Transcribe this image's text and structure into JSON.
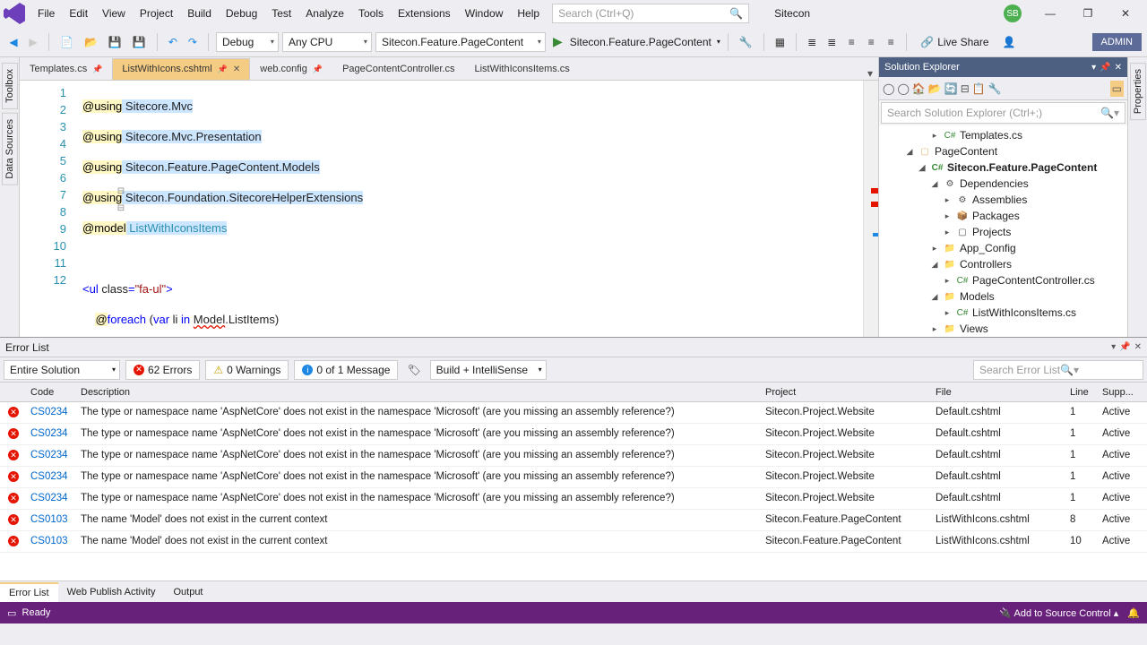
{
  "menu": [
    "File",
    "Edit",
    "View",
    "Project",
    "Build",
    "Debug",
    "Test",
    "Analyze",
    "Tools",
    "Extensions",
    "Window",
    "Help"
  ],
  "searchPlaceholder": "Search (Ctrl+Q)",
  "solutionName": "Sitecon",
  "avatar": "SB",
  "toolbar": {
    "config": "Debug",
    "platform": "Any CPU",
    "startup": "Sitecon.Feature.PageContent",
    "runTarget": "Sitecon.Feature.PageContent",
    "liveShare": "Live Share",
    "admin": "ADMIN"
  },
  "leftTabs": [
    "Toolbox",
    "Data Sources"
  ],
  "rightTab": "Properties",
  "docTabs": [
    {
      "name": "Templates.cs",
      "active": false,
      "pin": true
    },
    {
      "name": "ListWithIcons.cshtml",
      "active": true,
      "pin": true,
      "close": true
    },
    {
      "name": "web.config",
      "active": false,
      "pin": true
    },
    {
      "name": "PageContentController.cs",
      "active": false
    },
    {
      "name": "ListWithIconsItems.cs",
      "active": false
    }
  ],
  "code": {
    "lines": [
      "1",
      "2",
      "3",
      "4",
      "5",
      "6",
      "7",
      "8",
      "9",
      "10",
      "11",
      "12"
    ]
  },
  "solExp": {
    "title": "Solution Explorer",
    "search": "Search Solution Explorer (Ctrl+;)",
    "nodes": [
      {
        "indent": 4,
        "exp": "▸",
        "icon": "C#",
        "cls": "ic-cs",
        "label": "Templates.cs"
      },
      {
        "indent": 2,
        "exp": "◢",
        "icon": "▢",
        "cls": "ic-fold",
        "label": "PageContent"
      },
      {
        "indent": 3,
        "exp": "◢",
        "icon": "C#",
        "cls": "ic-cs",
        "label": "Sitecon.Feature.PageContent",
        "bold": true
      },
      {
        "indent": 4,
        "exp": "◢",
        "icon": "⚙",
        "cls": "ic-ref",
        "label": "Dependencies"
      },
      {
        "indent": 5,
        "exp": "▸",
        "icon": "⚙",
        "cls": "ic-ref",
        "label": "Assemblies"
      },
      {
        "indent": 5,
        "exp": "▸",
        "icon": "📦",
        "cls": "ic-ref",
        "label": "Packages"
      },
      {
        "indent": 5,
        "exp": "▸",
        "icon": "▢",
        "cls": "ic-ref",
        "label": "Projects"
      },
      {
        "indent": 4,
        "exp": "▸",
        "icon": "📁",
        "cls": "ic-fold",
        "label": "App_Config"
      },
      {
        "indent": 4,
        "exp": "◢",
        "icon": "📁",
        "cls": "ic-fold",
        "label": "Controllers"
      },
      {
        "indent": 5,
        "exp": "▸",
        "icon": "C#",
        "cls": "ic-cs",
        "label": "PageContentController.cs"
      },
      {
        "indent": 4,
        "exp": "◢",
        "icon": "📁",
        "cls": "ic-fold",
        "label": "Models"
      },
      {
        "indent": 5,
        "exp": "▸",
        "icon": "C#",
        "cls": "ic-cs",
        "label": "ListWithIconsItems.cs"
      },
      {
        "indent": 4,
        "exp": "▸",
        "icon": "📁",
        "cls": "ic-fold",
        "label": "Views"
      }
    ]
  },
  "errorList": {
    "title": "Error List",
    "scope": "Entire Solution",
    "errors": "62 Errors",
    "warnings": "0 Warnings",
    "messages": "0 of 1 Message",
    "buildIntel": "Build + IntelliSense",
    "search": "Search Error List",
    "headers": {
      "code": "Code",
      "desc": "Description",
      "proj": "Project",
      "file": "File",
      "line": "Line",
      "sup": "Supp..."
    },
    "rows": [
      {
        "code": "CS0234",
        "desc": "The type or namespace name 'AspNetCore' does not exist in the namespace 'Microsoft' (are you missing an assembly reference?)",
        "proj": "Sitecon.Project.Website",
        "file": "Default.cshtml",
        "line": "1",
        "sup": "Active"
      },
      {
        "code": "CS0234",
        "desc": "The type or namespace name 'AspNetCore' does not exist in the namespace 'Microsoft' (are you missing an assembly reference?)",
        "proj": "Sitecon.Project.Website",
        "file": "Default.cshtml",
        "line": "1",
        "sup": "Active"
      },
      {
        "code": "CS0234",
        "desc": "The type or namespace name 'AspNetCore' does not exist in the namespace 'Microsoft' (are you missing an assembly reference?)",
        "proj": "Sitecon.Project.Website",
        "file": "Default.cshtml",
        "line": "1",
        "sup": "Active"
      },
      {
        "code": "CS0234",
        "desc": "The type or namespace name 'AspNetCore' does not exist in the namespace 'Microsoft' (are you missing an assembly reference?)",
        "proj": "Sitecon.Project.Website",
        "file": "Default.cshtml",
        "line": "1",
        "sup": "Active"
      },
      {
        "code": "CS0234",
        "desc": "The type or namespace name 'AspNetCore' does not exist in the namespace 'Microsoft' (are you missing an assembly reference?)",
        "proj": "Sitecon.Project.Website",
        "file": "Default.cshtml",
        "line": "1",
        "sup": "Active"
      },
      {
        "code": "CS0103",
        "desc": "The name 'Model' does not exist in the current context",
        "proj": "Sitecon.Feature.PageContent",
        "file": "ListWithIcons.cshtml",
        "line": "8",
        "sup": "Active"
      },
      {
        "code": "CS0103",
        "desc": "The name 'Model' does not exist in the current context",
        "proj": "Sitecon.Feature.PageContent",
        "file": "ListWithIcons.cshtml",
        "line": "10",
        "sup": "Active"
      }
    ]
  },
  "bottomTabs": [
    "Error List",
    "Web Publish Activity",
    "Output"
  ],
  "status": {
    "ready": "Ready",
    "src": "Add to Source Control"
  }
}
